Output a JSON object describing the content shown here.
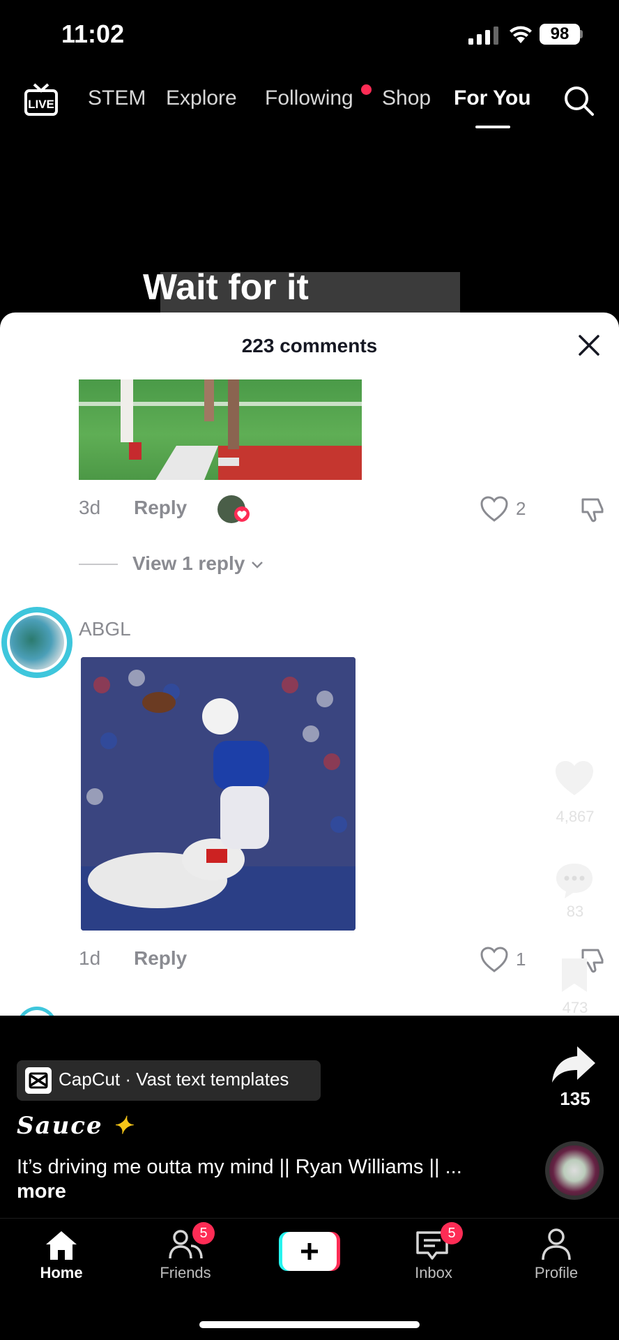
{
  "status_bar": {
    "time": "11:02",
    "battery": "98"
  },
  "top_nav": {
    "live_label": "LIVE",
    "items": [
      "STEM",
      "Explore",
      "Following",
      "Shop",
      "For You"
    ],
    "active": "For You"
  },
  "video": {
    "caption": "Wait for it"
  },
  "comments": {
    "title": "223 comments",
    "items": [
      {
        "age": "3d",
        "reply_label": "Reply",
        "likes": "2",
        "view_replies": "View 1 reply"
      },
      {
        "user": "ABGL",
        "age": "1d",
        "reply_label": "Reply",
        "likes": "1"
      }
    ]
  },
  "right_rail": {
    "likes": "4,867",
    "comments": "83",
    "saves": "473",
    "shares": "135"
  },
  "post": {
    "effect": "CapCut · Vast text templates",
    "author": "Sauce",
    "description": "It’s driving me outta my mind || Ryan Williams || ...",
    "more": "more"
  },
  "tab_bar": {
    "home": "Home",
    "friends": "Friends",
    "friends_badge": "5",
    "inbox": "Inbox",
    "inbox_badge": "5",
    "profile": "Profile"
  },
  "colors": {
    "accent": "#fe2c55",
    "teal": "#25f4ee"
  }
}
